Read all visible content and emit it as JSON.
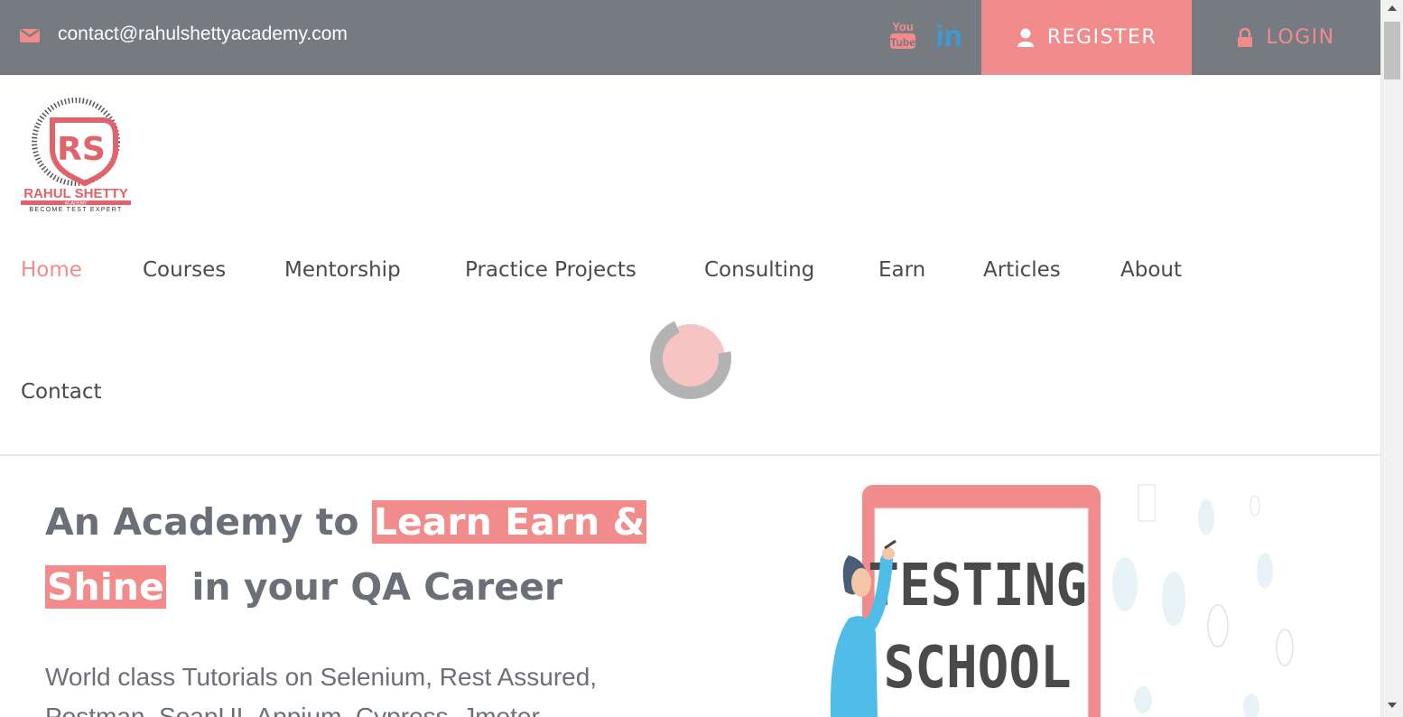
{
  "topbar": {
    "email": "contact@rahulshettyacademy.com",
    "icons": [
      "mail-icon",
      "youtube-icon",
      "linkedin-icon",
      "user-icon",
      "lock-icon"
    ],
    "youtube_text": [
      "You",
      "Tube"
    ],
    "linkedin_text": "in",
    "register_label": "REGISTER",
    "login_label": "LOGIN"
  },
  "logo": {
    "initials": "RS",
    "name": "RAHUL SHETTY",
    "small": "ACADEMY",
    "tagline": "BECOME TEST EXPERT"
  },
  "nav": {
    "items": [
      "Home",
      "Courses",
      "Mentorship",
      "Practice Projects",
      "Consulting",
      "Earn",
      "Articles",
      "About",
      "Contact"
    ],
    "active": "Home"
  },
  "hero": {
    "title_part1": "An Academy to ",
    "title_highlight1": "Learn Earn &",
    "title_highlight2": "Shine",
    "title_part2": "  in your QA Career",
    "subtitle": "World class Tutorials on Selenium, Rest Assured, Postman, SoapUI, Appium, Cypress, Jmeter"
  },
  "illustration": {
    "board_line1": "TESTING",
    "board_line2": "SCHOOL"
  },
  "colors": {
    "accent": "#f28c8c",
    "topbar": "#767b82",
    "text": "#6b7078",
    "youtube": "#f28c8c",
    "linkedin": "#3a9bd9"
  }
}
